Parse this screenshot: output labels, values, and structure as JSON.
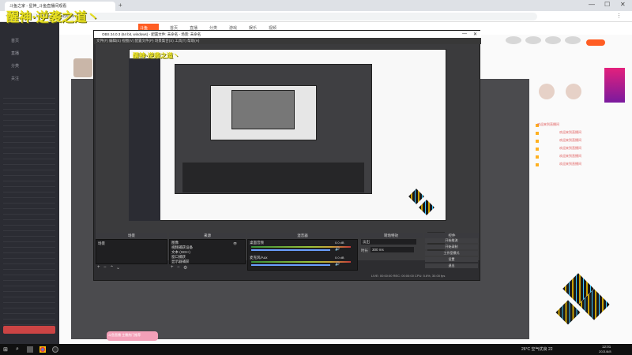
{
  "browser": {
    "tab_title": "斗鱼之家 - 星神_斗鱼直播间观看",
    "new_tab": "+",
    "url": "https://www.douyu.com/",
    "min": "—",
    "max": "☐",
    "close": "✕"
  },
  "site": {
    "left_items": [
      "首页",
      "直播",
      "分类",
      "关注"
    ],
    "nav_items": [
      "首页",
      "直播",
      "分类",
      "游戏",
      "娱乐",
      "视频"
    ],
    "brand": "斗鱼",
    "chat_lines": [
      "欢迎来到直播间",
      "欢迎来到直播间",
      "欢迎来到直播间",
      "欢迎来到直播间",
      "欢迎来到直播间",
      "欢迎来到直播间"
    ],
    "watermark": "醒神·逆袭之道丶",
    "bottom_banner": "斗鱼直播 主播热门推荐"
  },
  "obs": {
    "title": "OBS 24.0.3 (64 bit, windows) - 配置文件: 未命名 - 场景: 未命名",
    "menu": [
      "文件(F)",
      "编辑(E)",
      "视图(V)",
      "配置文件(P)",
      "场景集合(S)",
      "工具(T)",
      "帮助(H)"
    ],
    "panels": {
      "scenes": "场景",
      "sources": "来源",
      "mixer": "混音器",
      "transitions": "转场特效",
      "controls": "控件"
    },
    "scene_items": [
      "场景"
    ],
    "source_items": [
      "图像",
      "视频捕获设备",
      "文本 (GDI+)",
      "窗口捕获",
      "显示器捕获"
    ],
    "mixer_tracks": [
      "桌面音频",
      "麦克风/Aux"
    ],
    "mixer_db": [
      "0.0 dB",
      "0.0 dB"
    ],
    "transition_type": "淡出",
    "duration_label": "时长",
    "duration_value": "300 ms",
    "control_buttons": [
      "开始推流",
      "开始录制",
      "工作室模式",
      "设置",
      "退出"
    ],
    "status": "LIVE: 00:00:00   REC: 00:00:00   CPU: 5.6%, 30.00 fps"
  },
  "taskbar": {
    "weather": "26°C 空气优良 22",
    "time": "12:01",
    "date": "2021/8/8"
  },
  "colors": {
    "obs_bg": "#2d2d30",
    "accent_orange": "#ff5d23",
    "watermark": "#e8e020"
  }
}
